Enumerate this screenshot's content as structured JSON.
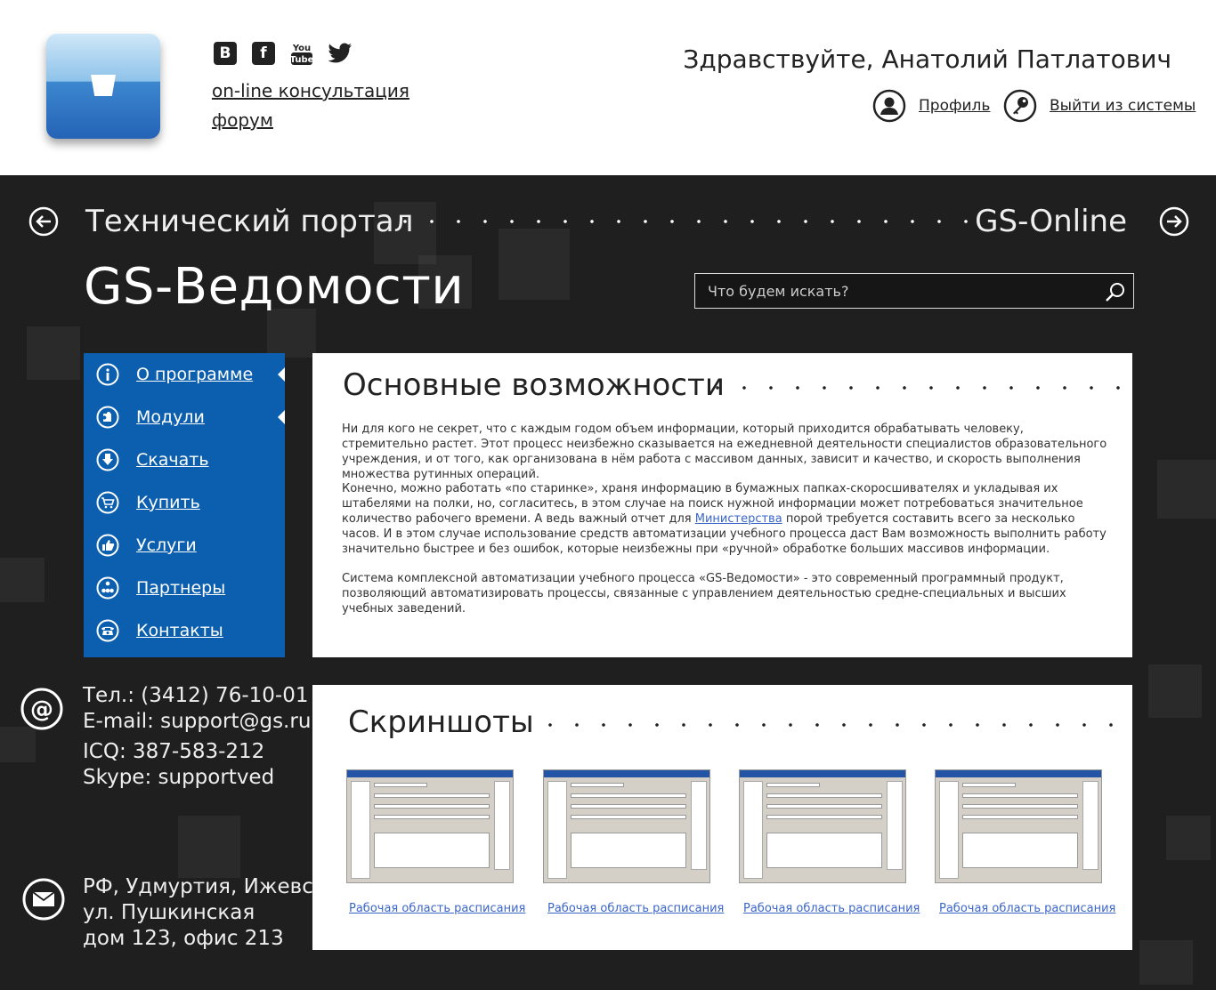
{
  "header": {
    "social": [
      "vkontakte-icon",
      "facebook-icon",
      "youtube-icon",
      "twitter-icon"
    ],
    "links": {
      "consult": "on-line консультация",
      "forum": "форум"
    },
    "greeting": "Здравствуйте, Анатолий Патлатович",
    "profile": "Профиль",
    "logout": "Выйти из системы"
  },
  "nav": {
    "left": "Технический портал",
    "right": "GS-Online"
  },
  "page_title": "GS-Ведомости",
  "search": {
    "placeholder": "Что будем искать?"
  },
  "menu": [
    {
      "label": "О программе",
      "icon": "info-icon"
    },
    {
      "label": "Модули",
      "icon": "puzzle-icon"
    },
    {
      "label": "Скачать",
      "icon": "download-icon"
    },
    {
      "label": "Купить",
      "icon": "cart-icon"
    },
    {
      "label": "Услуги",
      "icon": "thumbs-up-icon"
    },
    {
      "label": "Партнеры",
      "icon": "network-icon"
    },
    {
      "label": "Контакты",
      "icon": "phone-icon"
    }
  ],
  "contacts": {
    "phone": "Тел.: (3412) 76-10-01",
    "email": "E-mail: support@gs.ru",
    "icq": "ICQ: 387-583-212",
    "skype": "Skype: supportved",
    "address1": "РФ, Удмуртия, Ижевск",
    "address2": "ул. Пушкинская",
    "address3": "дом 123, офис 213"
  },
  "features": {
    "title": "Основные возможности",
    "p1": "Ни для кого не секрет, что с каждым годом объем информации, который приходится обрабатывать человеку, стремительно растет. Этот процесс неизбежно сказывается на ежедневной деятельности специалистов образовательного учреждения, и от того, как организована в нём работа с массивом данных, зависит и качество, и скорость выполнения множества рутинных операций.",
    "p2a": "Конечно, можно работать «по старинке», храня информацию в бумажных папках-скоросшивателях и укладывая их штабелями на полки, но, согласитесь, в этом случае на поиск нужной информации может потребоваться значительное количество рабочего времени. А ведь важный отчет для ",
    "p2link": "Министерства",
    "p2b": " порой требуется составить всего за несколько часов. И в этом случае использование средств автоматизации учебного процесса даст Вам возможность выполнить работу значительно быстрее и без ошибок, которые неизбежны при «ручной» обработке больших массивов информации.",
    "p3": "Система комплексной автоматизации учебного процесса «GS-Ведомости» - это современный программный продукт, позволяющий автоматизировать процессы, связанные с управлением деятельностью средне-специальных и высших учебных заведений."
  },
  "screens": {
    "title": "Скриншоты",
    "items": [
      "Рабочая область расписания",
      "Рабочая область расписания",
      "Рабочая область расписания",
      "Рабочая область расписания"
    ]
  }
}
